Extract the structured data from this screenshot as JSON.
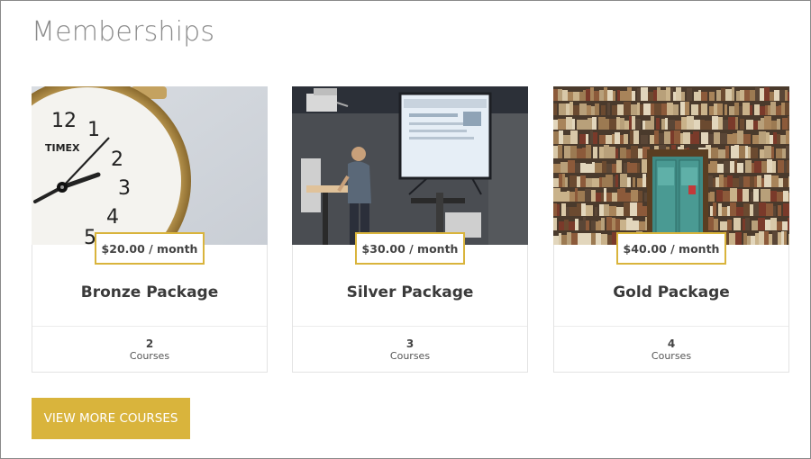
{
  "page": {
    "title": "Memberships"
  },
  "colors": {
    "accent": "#d9b43c",
    "title": "#8c8c8c",
    "border": "#e3e3e3"
  },
  "cards": [
    {
      "name": "Bronze Package",
      "price": "$20.00 / month",
      "courses_count": "2",
      "courses_label": "Courses",
      "image": "alarm-clock-photo",
      "clock_brand": "TIMEX"
    },
    {
      "name": "Silver Package",
      "price": "$30.00 / month",
      "courses_count": "3",
      "courses_label": "Courses",
      "image": "presenter-projector-photo"
    },
    {
      "name": "Gold Package",
      "price": "$40.00 / month",
      "courses_count": "4",
      "courses_label": "Courses",
      "image": "bookshelf-door-photo"
    }
  ],
  "actions": {
    "view_more": "VIEW MORE COURSES"
  }
}
